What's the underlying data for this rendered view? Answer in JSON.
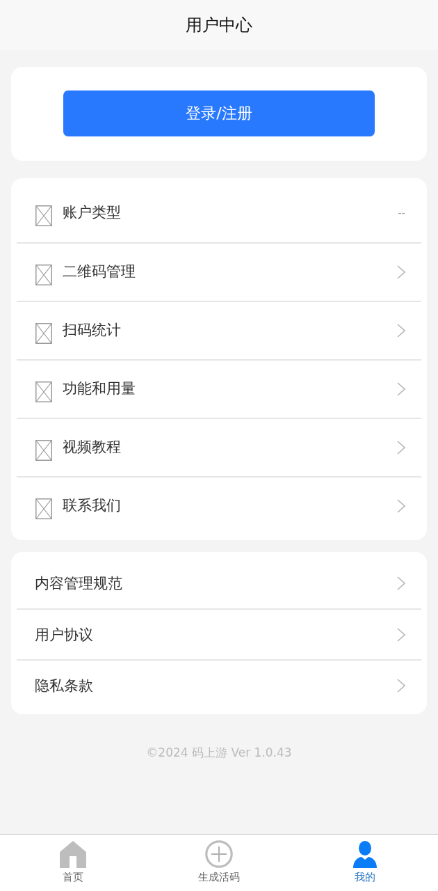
{
  "header": {
    "title": "用户中心"
  },
  "login_card": {
    "button": "登录/注册"
  },
  "menu": [
    {
      "label": "账户类型",
      "kind": "value",
      "value": "--"
    },
    {
      "label": "二维码管理",
      "kind": "link"
    },
    {
      "label": "扫码统计",
      "kind": "link"
    },
    {
      "label": "功能和用量",
      "kind": "link"
    },
    {
      "label": "视频教程",
      "kind": "link"
    },
    {
      "label": "联系我们",
      "kind": "link"
    }
  ],
  "links": [
    {
      "label": "内容管理规范"
    },
    {
      "label": "用户协议"
    },
    {
      "label": "隐私条款"
    }
  ],
  "footer": "©2024 码上游 Ver 1.0.43",
  "tab_bar": [
    {
      "label": "首页",
      "kind": "home",
      "selected": false
    },
    {
      "label": "生成活码",
      "kind": "add",
      "selected": false
    },
    {
      "label": "我的",
      "kind": "profile",
      "selected": true
    }
  ]
}
